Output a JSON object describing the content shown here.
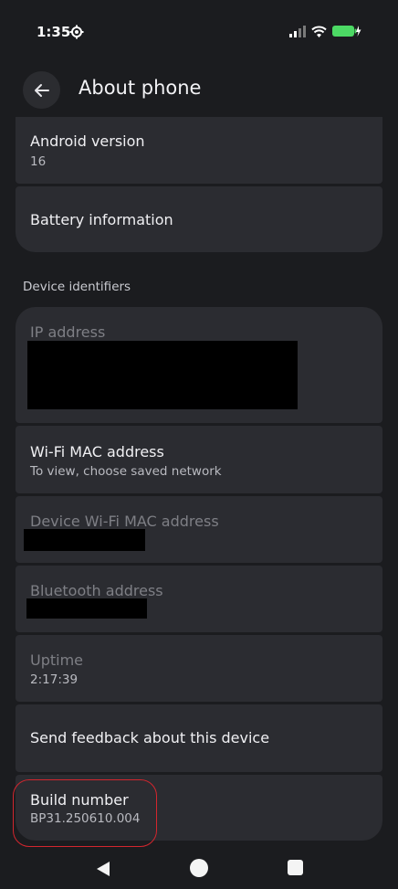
{
  "status": {
    "time": "1:35",
    "icons": [
      "gear-icon",
      "signal-icon",
      "wifi-icon",
      "battery-charging-icon"
    ],
    "battery_color": "#4cd964"
  },
  "header": {
    "back_icon": "arrow-left-icon",
    "title": "About phone"
  },
  "items_top": [
    {
      "title": "Android version",
      "subtitle": "16"
    },
    {
      "title": "Battery information"
    }
  ],
  "section": {
    "label": "Device identifiers"
  },
  "items_identifiers": [
    {
      "title": "IP address",
      "subtitle": "[redacted]"
    },
    {
      "title": "Wi-Fi MAC address",
      "subtitle": "To view, choose saved network"
    },
    {
      "title": "Device Wi-Fi MAC address",
      "subtitle": "[redacted]"
    },
    {
      "title": "Bluetooth address",
      "subtitle": "[redacted]"
    },
    {
      "title": "Uptime",
      "subtitle": "2:17:39"
    },
    {
      "title": "Send feedback about this device"
    },
    {
      "title": "Build number",
      "subtitle": "BP31.250610.004"
    }
  ],
  "navbar": {
    "icons": [
      "nav-back-icon",
      "nav-home-icon",
      "nav-recents-icon"
    ]
  },
  "colors": {
    "background": "#1b1c1f",
    "card": "#2b2c31",
    "highlight": "#d3262e"
  }
}
